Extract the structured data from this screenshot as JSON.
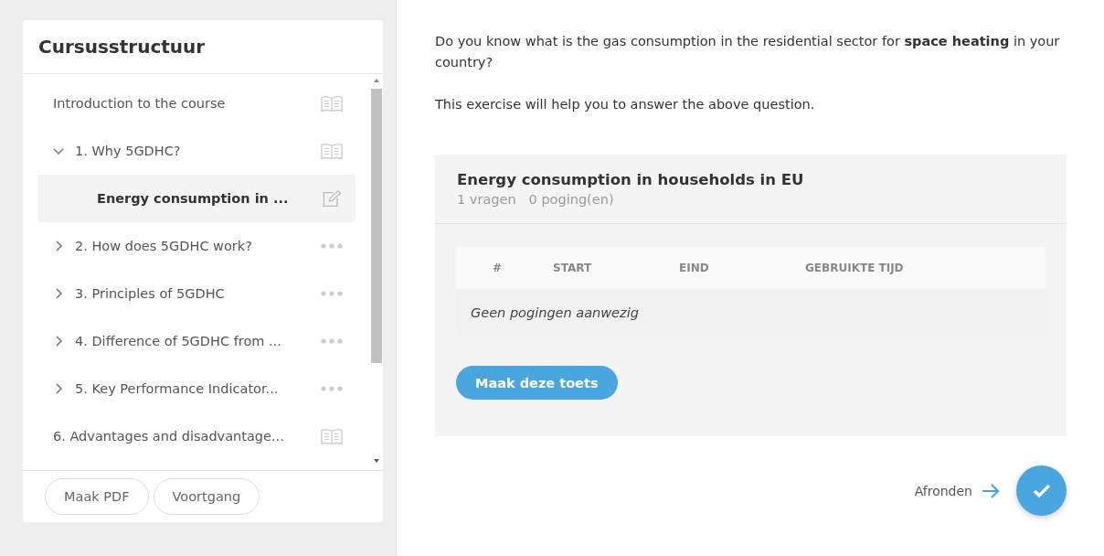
{
  "sidebar": {
    "title": "Cursusstructuur",
    "items": [
      {
        "label": "Introduction to the course",
        "kind": "lesson",
        "selected": false
      },
      {
        "label": "1. Why 5GDHC?",
        "kind": "lesson",
        "expanded": true,
        "selected": false,
        "children": [
          {
            "label": "Energy consumption in ...",
            "kind": "quiz",
            "selected": true
          }
        ]
      },
      {
        "label": "2. How does 5GDHC work?",
        "kind": "section",
        "expanded": false,
        "selected": false
      },
      {
        "label": "3. Principles of 5GDHC",
        "kind": "section",
        "expanded": false,
        "selected": false
      },
      {
        "label": "4. Difference of 5GDHC from ...",
        "kind": "section",
        "expanded": false,
        "selected": false
      },
      {
        "label": "5. Key Performance Indicator...",
        "kind": "section",
        "expanded": false,
        "selected": false
      },
      {
        "label": "6. Advantages and disadvantage...",
        "kind": "lesson",
        "selected": false
      }
    ],
    "buttons": [
      "Maak PDF",
      "Voortgang"
    ]
  },
  "intro": [
    "Do you know what is the gas consumption in the residential sector for **space heating** in your country?",
    "This exercise will help you to answer the above question."
  ],
  "quiz": {
    "title": "Energy consumption in households in EU",
    "meta": [
      "1 vragen",
      "0 poging(en)"
    ],
    "columns": [
      "#",
      "START",
      "EIND",
      "GEBRUIKTE TIJD"
    ],
    "empty": "Geen pogingen aanwezig",
    "button": "Maak deze toets"
  },
  "finish": {
    "label": "Afronden"
  }
}
